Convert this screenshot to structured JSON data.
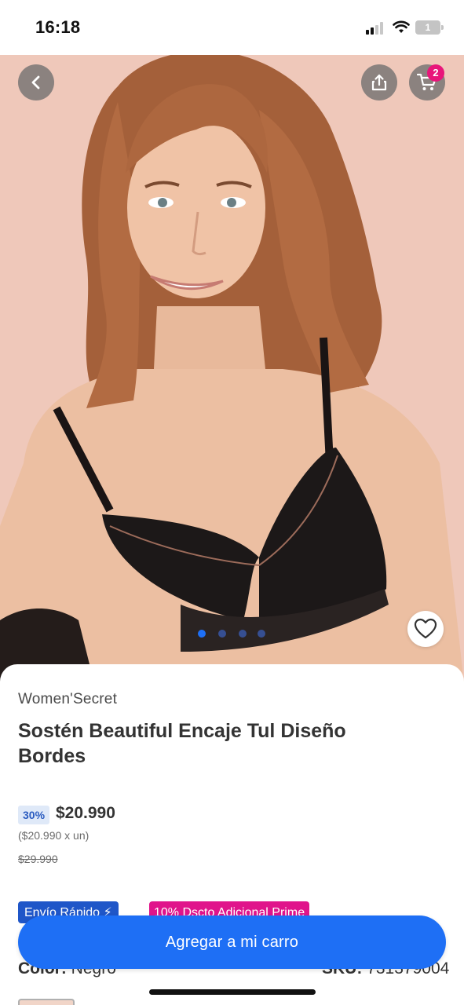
{
  "status_bar": {
    "time": "16:18",
    "battery_level": "1"
  },
  "top_actions": {
    "back_icon": "chevron-left-icon",
    "share_icon": "share-icon",
    "cart_icon": "cart-icon",
    "cart_count": "2"
  },
  "gallery": {
    "image_count": 4,
    "active_index": 0,
    "favorite_icon": "heart-icon"
  },
  "product": {
    "brand": "Women'Secret",
    "title": "Sostén Beautiful Encaje Tul Diseño Bordes",
    "discount": "30%",
    "price": "$20.990",
    "unit_price": "($20.990 x un)",
    "old_price": "$29.990",
    "badges": {
      "fast_shipping": "Envío Rápido ⚡",
      "prime": "10% Dscto Adicional Prime"
    },
    "color_label": "Color:",
    "color_value": "Negro",
    "sku_label": "SKU:",
    "sku_value": "731379004"
  },
  "add_to_cart_label": "Agregar a mi carro",
  "colors": {
    "primary": "#1e6ff5",
    "badge_fast": "#1f56c8",
    "badge_prime": "#e0148b",
    "cart_badge": "#e8167a",
    "discount_bg": "#dfe9f8"
  }
}
